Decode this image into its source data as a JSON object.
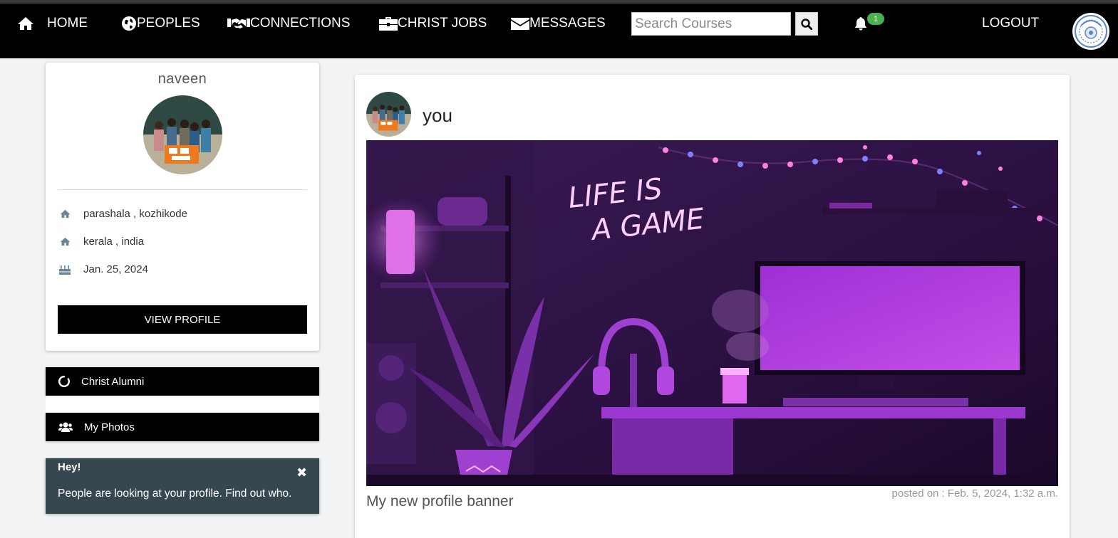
{
  "nav": {
    "home": "HOME",
    "peoples": "PEOPLES",
    "connections": "CONNECTIONS",
    "jobs": "CHRIST JOBS",
    "messages": "MESSAGES",
    "search_placeholder": "Search Courses",
    "notification_count": "1",
    "logout": "LOGOUT",
    "icons": [
      "home-icon",
      "globe-icon",
      "handshake-icon",
      "briefcase-icon",
      "envelope-icon",
      "search-icon",
      "bell-icon"
    ]
  },
  "profile": {
    "name": "naveen",
    "address_line": "parashala , kozhikode",
    "region_line": "kerala , india",
    "birthday": "Jan. 25, 2024",
    "view_profile_label": "VIEW PROFILE"
  },
  "sidebar": {
    "alumni_label": "Christ Alumni",
    "photos_label": "My Photos"
  },
  "notice": {
    "title": "Hey!",
    "text": "People are looking at your profile. Find out who."
  },
  "post": {
    "user": "you",
    "image_text": "LIFE IS A GAME",
    "caption": "My new profile banner",
    "posted_on": "posted on : Feb. 5, 2024, 1:32 a.m."
  },
  "colors": {
    "navbar": "#000000",
    "badge": "#4caf50",
    "notice_bg": "#37474f",
    "icon_grey": "#6b8696"
  }
}
